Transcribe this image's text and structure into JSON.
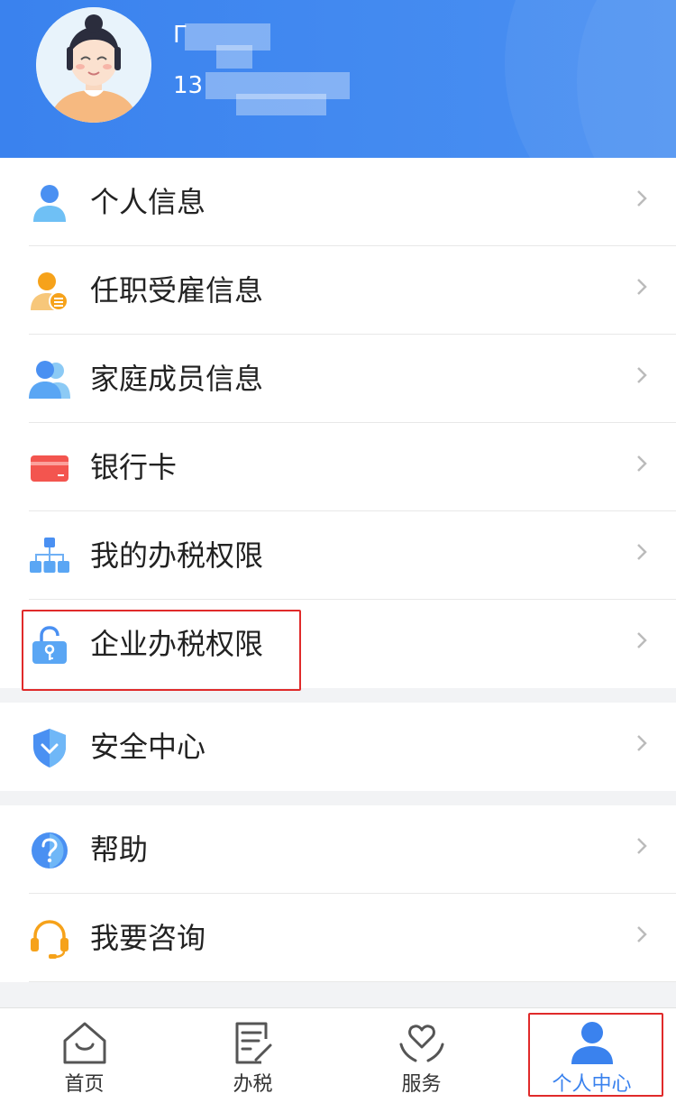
{
  "header": {
    "name": "Γ",
    "phone": "13"
  },
  "menu_group_1": [
    {
      "label": "个人信息",
      "icon": "person-icon"
    },
    {
      "label": "任职受雇信息",
      "icon": "employment-icon"
    },
    {
      "label": "家庭成员信息",
      "icon": "family-icon"
    },
    {
      "label": "银行卡",
      "icon": "bank-card-icon"
    },
    {
      "label": "我的办税权限",
      "icon": "org-chart-icon"
    },
    {
      "label": "企业办税权限",
      "icon": "lock-icon"
    }
  ],
  "menu_group_2": [
    {
      "label": "安全中心",
      "icon": "shield-icon"
    }
  ],
  "menu_group_3": [
    {
      "label": "帮助",
      "icon": "help-icon"
    },
    {
      "label": "我要咨询",
      "icon": "headset-icon"
    }
  ],
  "tabbar": [
    {
      "label": "首页",
      "icon": "home-icon"
    },
    {
      "label": "办税",
      "icon": "tax-form-icon"
    },
    {
      "label": "服务",
      "icon": "service-heart-icon"
    },
    {
      "label": "个人中心",
      "icon": "person-icon"
    }
  ],
  "colors": {
    "primary": "#3a82ee",
    "highlight_border": "#e02a2a"
  }
}
